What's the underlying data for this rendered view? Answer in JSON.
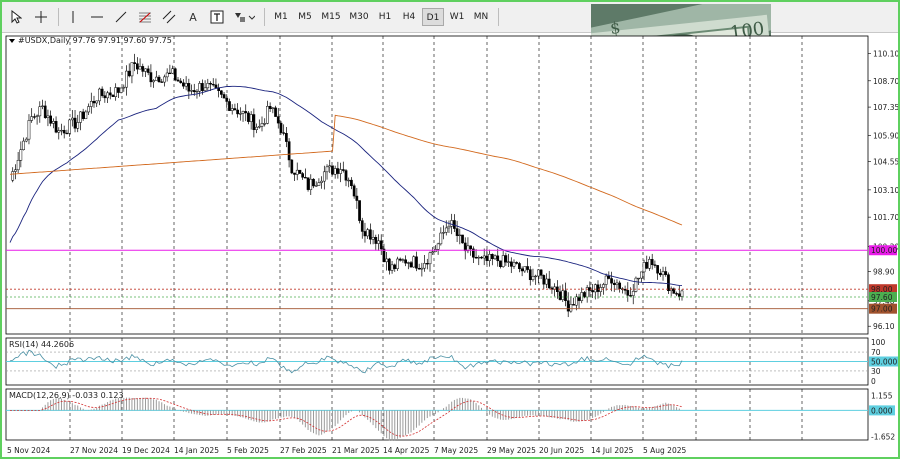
{
  "toolbar": {
    "tools": [
      {
        "name": "cursor-tool"
      },
      {
        "name": "crosshair-tool"
      },
      {
        "name": "vertical-line-tool"
      },
      {
        "name": "horizontal-line-tool"
      },
      {
        "name": "trendline-tool"
      },
      {
        "name": "fibonacci-tool"
      },
      {
        "name": "text-tool",
        "label": "A"
      },
      {
        "name": "text-label-tool",
        "label": "T"
      },
      {
        "name": "shapes-tool"
      }
    ],
    "timeframes": [
      "M1",
      "M5",
      "M15",
      "M30",
      "H1",
      "H4",
      "D1",
      "W1",
      "MN"
    ],
    "active_timeframe": "D1"
  },
  "main_chart": {
    "header": "#USDX,Daily  97.76 97.91 97.60 97.75",
    "price_labels": [
      "110.10",
      "108.70",
      "107.35",
      "105.90",
      "104.55",
      "103.10",
      "101.70",
      "100.20",
      "98.90",
      "97.40",
      "96.10"
    ],
    "level_labels": {
      "magenta": "100.00",
      "red": "98.00",
      "green": "97.60",
      "orange": "97.00"
    },
    "colors": {
      "magenta": "#e81ce8",
      "red": "#c0392b",
      "green": "#4caf50",
      "orange": "#a0522d",
      "ma_blue": "#1a237e",
      "ma_orange": "#d2691e",
      "candle": "#000000"
    }
  },
  "rsi": {
    "header": "RSI(14) 44.2606",
    "labels": [
      "100",
      "70",
      "50.000",
      "30",
      "0"
    ],
    "color": "#4a90a4"
  },
  "macd": {
    "header": "MACD(12,26,9) -0.033 0.123",
    "labels": [
      "1.155",
      "0.000",
      "-1.652"
    ],
    "signal_color": "#d32f2f"
  },
  "date_labels": [
    "5 Nov 2024",
    "27 Nov 2024",
    "19 Dec 2024",
    "14 Jan 2025",
    "5 Feb 2025",
    "27 Feb 2025",
    "21 Mar 2025",
    "14 Apr 2025",
    "7 May 2025",
    "29 May 2025",
    "20 Jun 2025",
    "14 Jul 2025",
    "5 Aug 2025"
  ],
  "chart_data": {
    "type": "candlestick",
    "symbol": "#USDX",
    "timeframe": "D1",
    "ohlc_last": {
      "open": 97.76,
      "high": 97.91,
      "low": 97.6,
      "close": 97.75
    },
    "close_path": [
      {
        "date": "5 Nov 2024",
        "close": 103.5
      },
      {
        "date": "27 Nov 2024",
        "close": 106.3
      },
      {
        "date": "19 Dec 2024",
        "close": 108.2
      },
      {
        "date": "14 Jan 2025",
        "close": 109.3
      },
      {
        "date": "5 Feb 2025",
        "close": 107.8
      },
      {
        "date": "27 Feb 2025",
        "close": 107.3
      },
      {
        "date": "21 Mar 2025",
        "close": 104.0
      },
      {
        "date": "14 Apr 2025",
        "close": 99.5
      },
      {
        "date": "7 May 2025",
        "close": 100.2
      },
      {
        "date": "29 May 2025",
        "close": 99.2
      },
      {
        "date": "20 Jun 2025",
        "close": 97.8
      },
      {
        "date": "14 Jul 2025",
        "close": 97.9
      },
      {
        "date": "5 Aug 2025",
        "close": 98.6
      },
      {
        "date": "last",
        "close": 97.75
      }
    ],
    "horizontal_levels": [
      100.0,
      98.0,
      97.6,
      97.0
    ],
    "rsi_value": 44.2606,
    "macd": {
      "main": -0.033,
      "signal": 0.123
    }
  }
}
